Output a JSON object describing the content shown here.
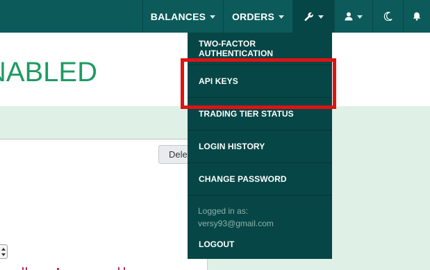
{
  "navbar": {
    "balances_label": "BALANCES",
    "orders_label": "ORDERS",
    "icons": [
      "wrench-icon",
      "user-icon",
      "moon-icon",
      "bell-icon"
    ]
  },
  "page": {
    "title": "NABLED",
    "delete_label": "Delete"
  },
  "dropdown": {
    "items": [
      {
        "label": "TWO-FACTOR AUTHENTICATION"
      },
      {
        "label": "API KEYS"
      },
      {
        "label": "TRADING TIER STATUS"
      },
      {
        "label": "LOGIN HISTORY"
      },
      {
        "label": "CHANGE PASSWORD"
      }
    ],
    "logged_in_label": "Logged in as:",
    "logged_in_email": "versy93@gmail.com",
    "logout_label": "LOGOUT"
  },
  "colors": {
    "navbar": "#0c5a5a",
    "dropdown": "#064646",
    "title_green": "#1e9b62",
    "highlight_red": "#e11212"
  }
}
